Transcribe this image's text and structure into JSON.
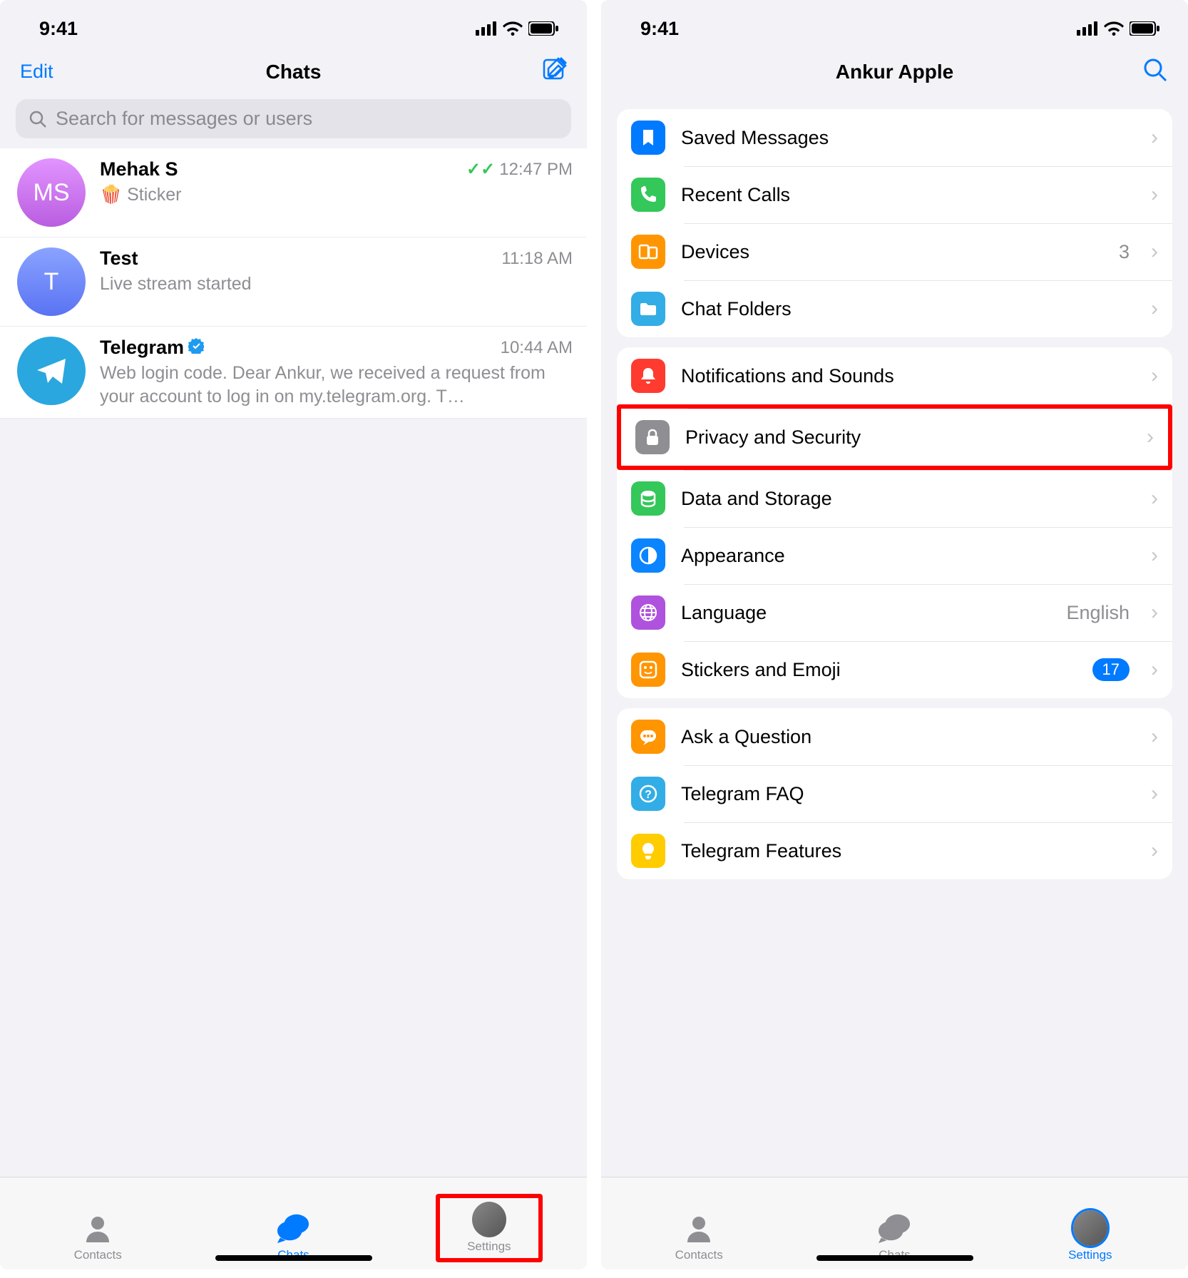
{
  "left": {
    "status": {
      "time": "9:41"
    },
    "nav": {
      "left": "Edit",
      "title": "Chats"
    },
    "search": {
      "placeholder": "Search for messages or users"
    },
    "chats": [
      {
        "initials": "MS",
        "name": "Mehak S",
        "preview": "🍿 Sticker",
        "time": "12:47 PM",
        "read": true,
        "avatarColor": "linear-gradient(180deg,#e294ff,#b95de0)"
      },
      {
        "initials": "T",
        "name": "Test",
        "preview": "Live stream started",
        "time": "11:18 AM",
        "read": false,
        "avatarColor": "linear-gradient(180deg,#8aa3ff,#5a73f3)"
      },
      {
        "initials": "",
        "name": "Telegram",
        "preview": "Web login code. Dear Ankur, we received a request from your account to log in on my.telegram.org. T…",
        "time": "10:44 AM",
        "read": false,
        "verified": true,
        "avatarColor": "#2aa7df",
        "isTelegram": true
      }
    ],
    "tabs": {
      "contacts": "Contacts",
      "chats": "Chats",
      "settings": "Settings"
    }
  },
  "right": {
    "status": {
      "time": "9:41"
    },
    "nav": {
      "title": "Ankur Apple"
    },
    "sections": [
      [
        {
          "icon": "bookmark",
          "color": "#007aff",
          "label": "Saved Messages"
        },
        {
          "icon": "phone",
          "color": "#34c759",
          "label": "Recent Calls"
        },
        {
          "icon": "devices",
          "color": "#ff9500",
          "label": "Devices",
          "value": "3"
        },
        {
          "icon": "folder",
          "color": "#32ade6",
          "label": "Chat Folders"
        }
      ],
      [
        {
          "icon": "bell",
          "color": "#ff3b30",
          "label": "Notifications and Sounds"
        },
        {
          "icon": "lock",
          "color": "#8e8e93",
          "label": "Privacy and Security",
          "highlight": true
        },
        {
          "icon": "data",
          "color": "#34c759",
          "label": "Data and Storage"
        },
        {
          "icon": "appearance",
          "color": "#0a84ff",
          "label": "Appearance"
        },
        {
          "icon": "globe",
          "color": "#af52de",
          "label": "Language",
          "value": "English"
        },
        {
          "icon": "sticker",
          "color": "#ff9500",
          "label": "Stickers and Emoji",
          "badge": "17"
        }
      ],
      [
        {
          "icon": "chat",
          "color": "#ff9500",
          "label": "Ask a Question"
        },
        {
          "icon": "question",
          "color": "#32ade6",
          "label": "Telegram FAQ"
        },
        {
          "icon": "bulb",
          "color": "#ffcc00",
          "label": "Telegram Features"
        }
      ]
    ],
    "tabs": {
      "contacts": "Contacts",
      "chats": "Chats",
      "settings": "Settings"
    }
  }
}
